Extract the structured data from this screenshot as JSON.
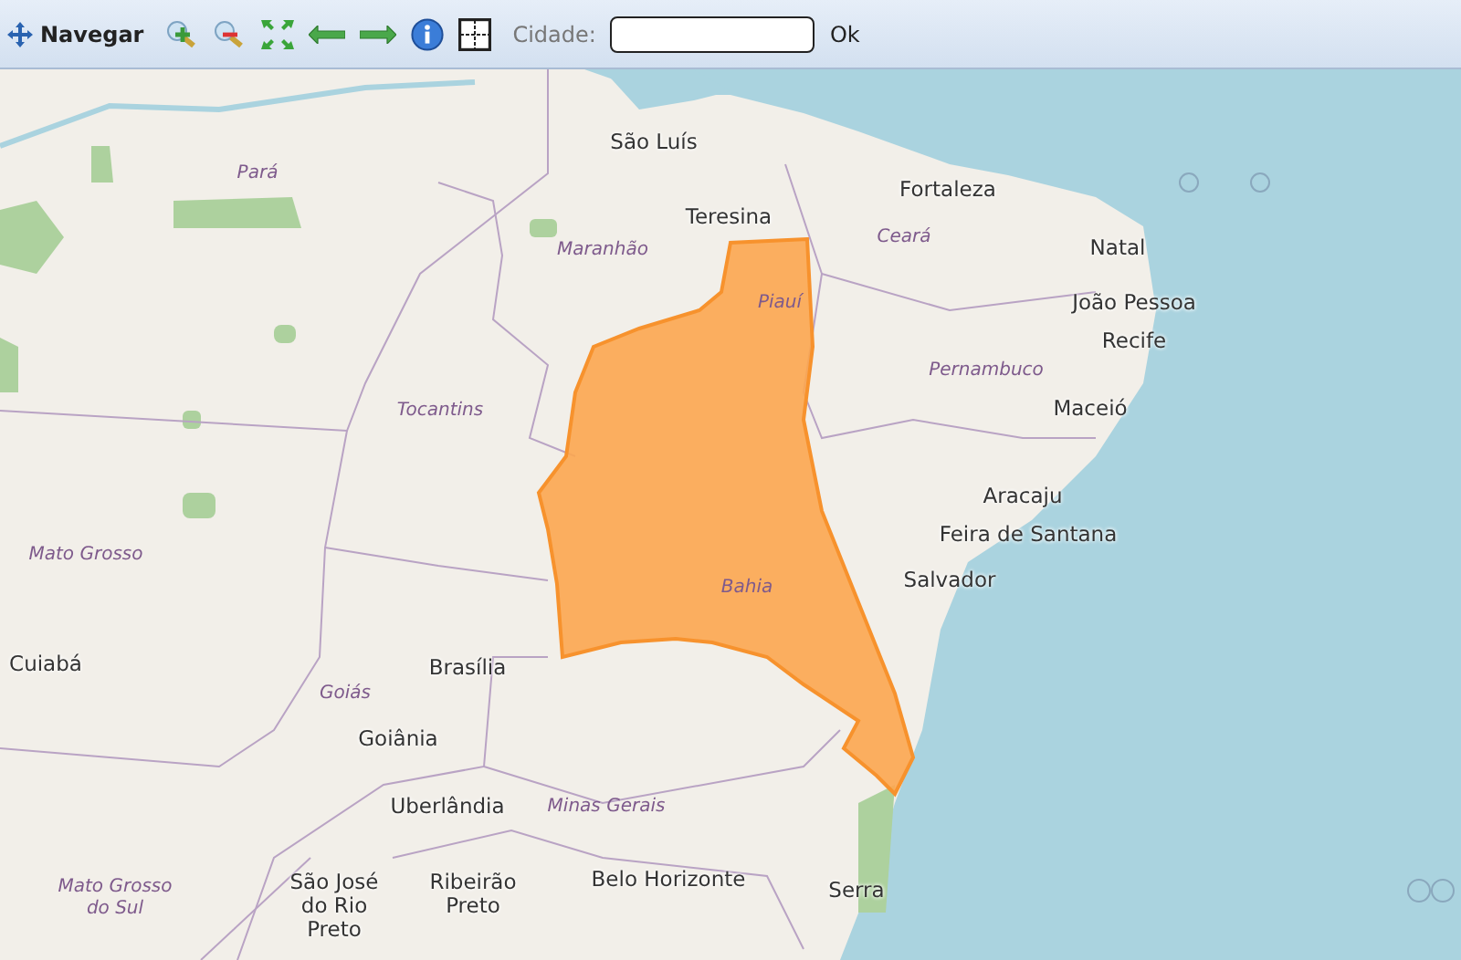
{
  "toolbar": {
    "navigate_label": "Navegar",
    "city_label": "Cidade:",
    "ok_label": "Ok"
  },
  "map": {
    "cities": [
      {
        "name": "São Luís"
      },
      {
        "name": "Teresina"
      },
      {
        "name": "Fortaleza"
      },
      {
        "name": "Natal"
      },
      {
        "name": "João Pessoa"
      },
      {
        "name": "Recife"
      },
      {
        "name": "Maceió"
      },
      {
        "name": "Aracaju"
      },
      {
        "name": "Feira de Santana"
      },
      {
        "name": "Salvador"
      },
      {
        "name": "Cuiabá"
      },
      {
        "name": "Brasília"
      },
      {
        "name": "Goiânia"
      },
      {
        "name": "Uberlândia"
      },
      {
        "name": "São José do Rio Preto"
      },
      {
        "name": "Ribeirão Preto"
      },
      {
        "name": "Belo Horizonte"
      },
      {
        "name": "Serra"
      }
    ],
    "states": [
      {
        "name": "Pará"
      },
      {
        "name": "Maranhão"
      },
      {
        "name": "Ceará"
      },
      {
        "name": "Piauí"
      },
      {
        "name": "Pernambuco"
      },
      {
        "name": "Tocantins"
      },
      {
        "name": "Mato Grosso"
      },
      {
        "name": "Bahia"
      },
      {
        "name": "Goiás"
      },
      {
        "name": "Minas Gerais"
      },
      {
        "name": "Mato Grosso do Sul"
      }
    ]
  }
}
